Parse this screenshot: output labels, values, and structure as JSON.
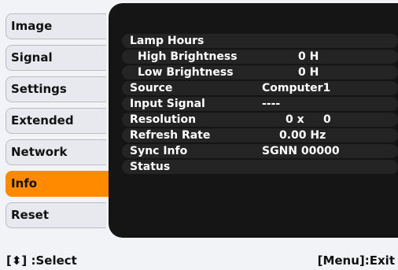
{
  "menu": {
    "items": [
      {
        "label": "Image"
      },
      {
        "label": "Signal"
      },
      {
        "label": "Settings"
      },
      {
        "label": "Extended"
      },
      {
        "label": "Network"
      },
      {
        "label": "Info"
      },
      {
        "label": "Reset"
      }
    ],
    "selected": "Info"
  },
  "info": {
    "rows": [
      {
        "label": "Lamp Hours",
        "value": ""
      },
      {
        "label": "High Brightness",
        "value": "0 H"
      },
      {
        "label": "Low Brightness",
        "value": "0 H"
      },
      {
        "label": "Source",
        "value": "Computer1"
      },
      {
        "label": "Input Signal",
        "value": "----"
      },
      {
        "label": "Resolution",
        "value": "0 x     0"
      },
      {
        "label": "Refresh Rate",
        "value": "0.00 Hz"
      },
      {
        "label": "Sync Info",
        "value": "SGNN 00000"
      },
      {
        "label": "Status",
        "value": ""
      }
    ]
  },
  "footer": {
    "select": "[⬍] :Select",
    "exit": "[Menu]:Exit"
  },
  "colors": {
    "accent": "#ff8a00",
    "panel": "#151515",
    "background": "#f1f3f6"
  }
}
